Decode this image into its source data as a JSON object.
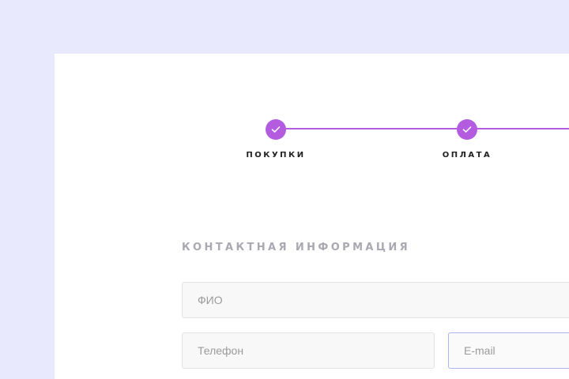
{
  "stepper": {
    "steps": [
      {
        "label": "ПОКУПКИ",
        "status": "completed",
        "icon": "check-icon"
      },
      {
        "label": "ОПЛАТА",
        "status": "completed",
        "icon": "check-icon"
      }
    ],
    "accent_color": "#b35ce0"
  },
  "contact": {
    "title": "КОНТАКТНАЯ ИНФОРМАЦИЯ",
    "fio_placeholder": "ФИО",
    "phone_placeholder": "Телефон",
    "email_placeholder": "E-mail"
  },
  "colors": {
    "page_background": "#e9e9fd",
    "card_background": "#ffffff",
    "focused_border": "#adb4e8"
  }
}
